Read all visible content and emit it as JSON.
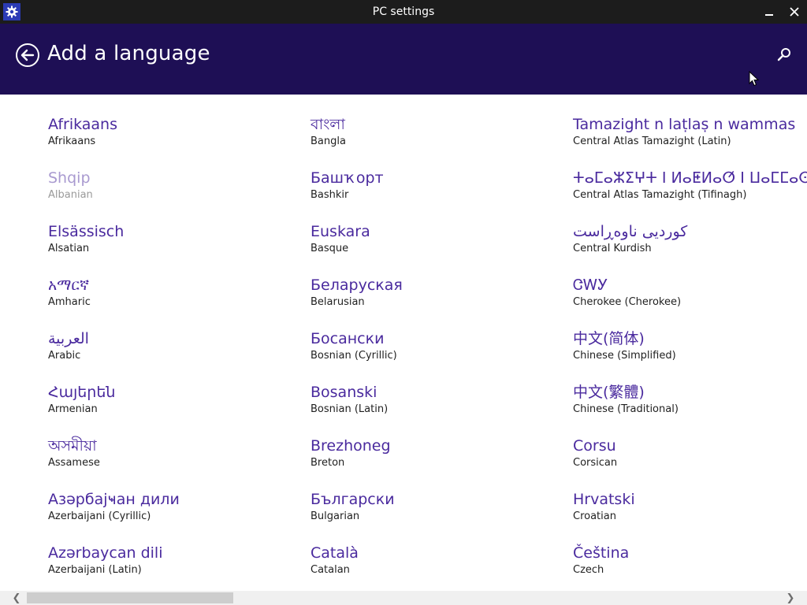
{
  "window": {
    "title": "PC settings",
    "app_icon": "gear-icon",
    "minimize_glyph": "–",
    "close_glyph": "✕"
  },
  "header": {
    "title": "Add a language",
    "back_icon": "back-arrow-icon",
    "search_icon": "search-icon",
    "background": "#1e0f55"
  },
  "colors": {
    "accent": "#4a2a9e",
    "text": "#1f1f1f",
    "disabled_native": "#a99ad0",
    "disabled_english": "#9a9a9a"
  },
  "columns": [
    [
      {
        "native": "Afrikaans",
        "english": "Afrikaans",
        "disabled": false
      },
      {
        "native": "Shqip",
        "english": "Albanian",
        "disabled": true
      },
      {
        "native": "Elsässisch",
        "english": "Alsatian",
        "disabled": false
      },
      {
        "native": "አማርኛ",
        "english": "Amharic",
        "disabled": false
      },
      {
        "native": "العربية",
        "english": "Arabic",
        "disabled": false
      },
      {
        "native": "Հայերեն",
        "english": "Armenian",
        "disabled": false
      },
      {
        "native": "অসমীয়া",
        "english": "Assamese",
        "disabled": false
      },
      {
        "native": "Азәрбајҹан дили",
        "english": "Azerbaijani (Cyrillic)",
        "disabled": false
      },
      {
        "native": "Azərbaycan dili",
        "english": "Azerbaijani (Latin)",
        "disabled": false
      }
    ],
    [
      {
        "native": "বাংলা",
        "english": "Bangla",
        "disabled": false
      },
      {
        "native": "Башҡорт",
        "english": "Bashkir",
        "disabled": false
      },
      {
        "native": "Euskara",
        "english": "Basque",
        "disabled": false
      },
      {
        "native": "Беларуская",
        "english": "Belarusian",
        "disabled": false
      },
      {
        "native": "Босански",
        "english": "Bosnian (Cyrillic)",
        "disabled": false
      },
      {
        "native": "Bosanski",
        "english": "Bosnian (Latin)",
        "disabled": false
      },
      {
        "native": "Brezhoneg",
        "english": "Breton",
        "disabled": false
      },
      {
        "native": "Български",
        "english": "Bulgarian",
        "disabled": false
      },
      {
        "native": "Català",
        "english": "Catalan",
        "disabled": false
      }
    ],
    [
      {
        "native": "Tamazight n laṭlaṣ n wammas",
        "english": "Central Atlas Tamazight (Latin)",
        "disabled": false
      },
      {
        "native": "ⵜⴰⵎⴰⵣⵉⵖⵜ ⵏ ⵍⴰⵟⵍⴰⵚ ⵏ ⵡⴰⵎⵎⴰⵙ",
        "english": "Central Atlas Tamazight (Tifinagh)",
        "disabled": false
      },
      {
        "native": "کوردیی ناوەڕاست",
        "english": "Central Kurdish",
        "disabled": false
      },
      {
        "native": "ᏣᎳᎩ",
        "english": "Cherokee (Cherokee)",
        "disabled": false
      },
      {
        "native": "中文(简体)",
        "english": "Chinese (Simplified)",
        "disabled": false
      },
      {
        "native": "中文(繁體)",
        "english": "Chinese (Traditional)",
        "disabled": false
      },
      {
        "native": "Corsu",
        "english": "Corsican",
        "disabled": false
      },
      {
        "native": "Hrvatski",
        "english": "Croatian",
        "disabled": false
      },
      {
        "native": "Čeština",
        "english": "Czech",
        "disabled": false
      }
    ]
  ],
  "scrollbar": {
    "left_icon": "chevron-left-icon",
    "right_icon": "chevron-right-icon",
    "left_glyph": "❮",
    "right_glyph": "❯"
  }
}
